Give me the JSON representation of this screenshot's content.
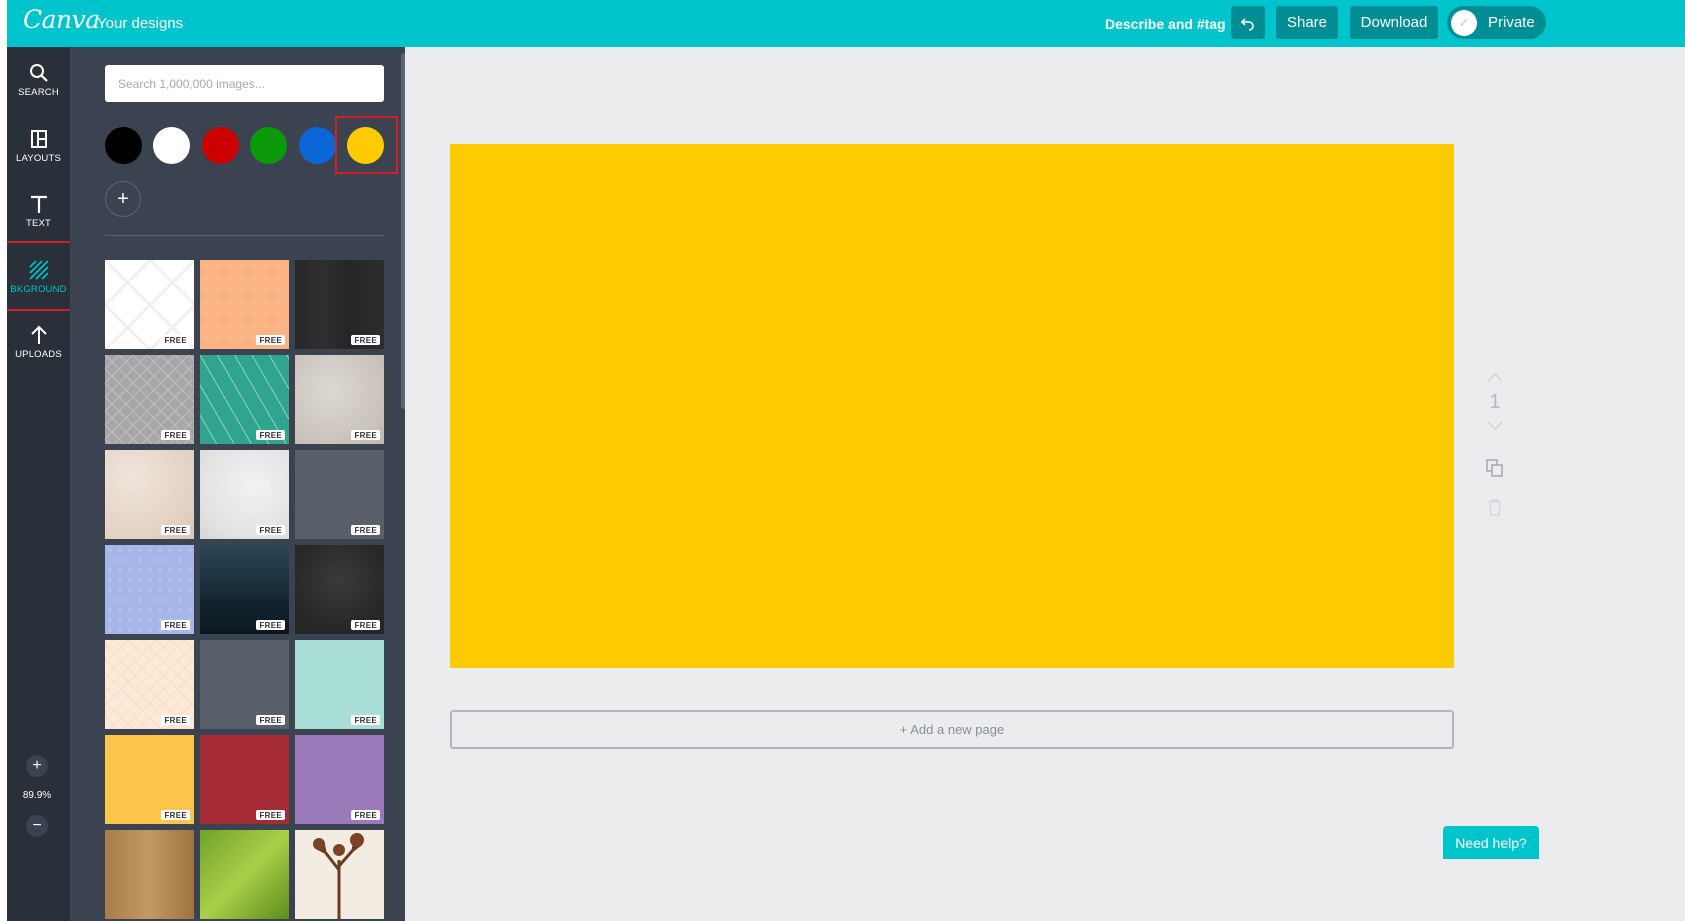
{
  "colors": {
    "brand": "#00c4cc",
    "brand_dark": "#008e95",
    "iconbar": "#293039",
    "panel": "#3b4350",
    "canvas_fill": "#fecb00",
    "highlight": "#d2202a"
  },
  "header": {
    "logo": "Canva",
    "nav_link": "Your designs",
    "tag_link": "Describe and #tag",
    "undo_icon": "undo-icon",
    "share_label": "Share",
    "download_label": "Download",
    "privacy_label": "Private",
    "privacy_icon": "check-icon"
  },
  "sidebar": {
    "items": [
      {
        "label": "SEARCH",
        "icon": "search-icon",
        "active": false
      },
      {
        "label": "LAYOUTS",
        "icon": "layouts-icon",
        "active": false
      },
      {
        "label": "TEXT",
        "icon": "text-icon",
        "active": false
      },
      {
        "label": "BKGROUND",
        "icon": "background-icon",
        "active": true
      },
      {
        "label": "UPLOADS",
        "icon": "upload-icon",
        "active": false
      }
    ],
    "zoom_in": "+",
    "zoom_out": "−",
    "zoom_level": "89.9%"
  },
  "panel": {
    "search_placeholder": "Search 1,000,000 images...",
    "swatches": [
      {
        "name": "black",
        "color": "#000000"
      },
      {
        "name": "white",
        "color": "#ffffff"
      },
      {
        "name": "red",
        "color": "#cc0000"
      },
      {
        "name": "green",
        "color": "#0a9a0a"
      },
      {
        "name": "blue",
        "color": "#0b67d6"
      },
      {
        "name": "yellow",
        "color": "#fecb00",
        "selected": true
      }
    ],
    "add_color": "+",
    "free_label": "FREE",
    "backgrounds": [
      {
        "style": "white-diamond",
        "free": true
      },
      {
        "style": "peach-pattern",
        "free": true
      },
      {
        "style": "dark-wood",
        "free": true
      },
      {
        "style": "grey-lattice",
        "free": true
      },
      {
        "style": "teal-stripes",
        "free": true
      },
      {
        "style": "stone",
        "free": true
      },
      {
        "style": "beige-texture",
        "free": true
      },
      {
        "style": "white-marble",
        "free": true
      },
      {
        "style": "slate",
        "free": true
      },
      {
        "style": "periwinkle-dots",
        "free": true
      },
      {
        "style": "navy-gradient",
        "free": true
      },
      {
        "style": "charcoal",
        "free": true
      },
      {
        "style": "cream-chevron",
        "free": true
      },
      {
        "style": "slate",
        "free": true
      },
      {
        "style": "mint",
        "free": true
      },
      {
        "style": "mustard",
        "free": true
      },
      {
        "style": "crimson",
        "free": true
      },
      {
        "style": "lavender",
        "free": true
      },
      {
        "style": "wood",
        "free": false
      },
      {
        "style": "leaf",
        "free": false
      },
      {
        "style": "tree",
        "free": false
      }
    ]
  },
  "canvas": {
    "add_page_label": "+ Add a new page",
    "page_number": "1",
    "move_up_icon": "chevron-up-icon",
    "move_down_icon": "chevron-down-icon",
    "copy_icon": "copy-icon",
    "delete_icon": "trash-icon"
  },
  "help": {
    "label": "Need help?"
  }
}
